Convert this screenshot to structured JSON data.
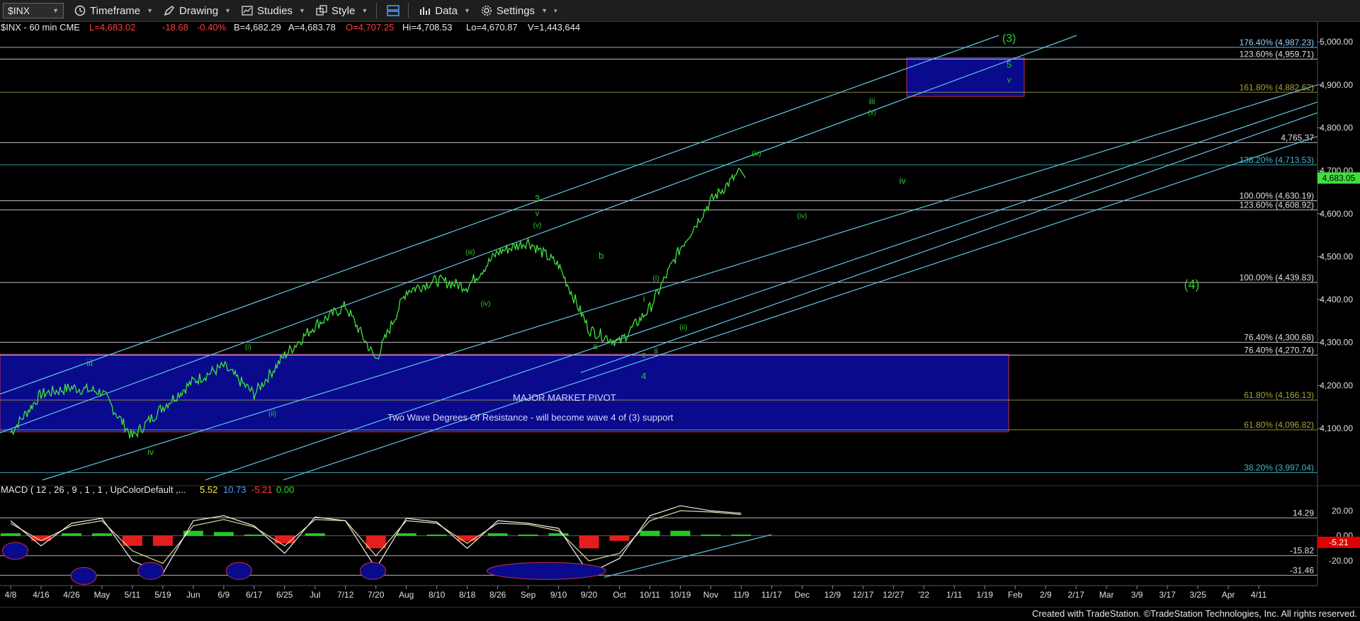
{
  "toolbar": {
    "symbol": "$INX",
    "timeframe": "Timeframe",
    "drawing": "Drawing",
    "studies": "Studies",
    "style": "Style",
    "data": "Data",
    "settings": "Settings"
  },
  "header": {
    "symbol_info": "$INX - 60 min  CME",
    "last": "L=4,683.02",
    "change": "-18.68",
    "change_pct": "-0.40%",
    "bid": "B=4,682.29",
    "ask": "A=4,683.78",
    "open": "O=4,707.25",
    "high": "Hi=4,708.53",
    "low": "Lo=4,670.87",
    "volume": "V=1,443,644"
  },
  "price_axis": {
    "ticks": [
      "5,000.00",
      "4,900.00",
      "4,800.00",
      "4,700.00",
      "4,600.00",
      "4,500.00",
      "4,400.00",
      "4,300.00",
      "4,200.00",
      "4,100.00"
    ],
    "last_price_tag": "4,683.05"
  },
  "date_axis": [
    "4/8",
    "4/16",
    "4/26",
    "May",
    "5/11",
    "5/19",
    "Jun",
    "6/9",
    "6/17",
    "6/25",
    "Jul",
    "7/12",
    "7/20",
    "Aug",
    "8/10",
    "8/18",
    "8/26",
    "Sep",
    "9/10",
    "9/20",
    "Oct",
    "10/11",
    "10/19",
    "Nov",
    "11/9",
    "11/17",
    "Dec",
    "12/9",
    "12/17",
    "12/27",
    "'22",
    "1/11",
    "1/19",
    "Feb",
    "2/9",
    "2/17",
    "Mar",
    "3/9",
    "3/17",
    "3/25",
    "Apr",
    "4/11"
  ],
  "fib_levels": [
    {
      "label": "176.40% (4,987.23)",
      "color": "#8fd3ff"
    },
    {
      "label": "123.60% (4,959.71)",
      "color": "#e0e0e0"
    },
    {
      "label": "161.80% (4,882.62)",
      "color": "#a8a23a"
    },
    {
      "label": "4,765.37",
      "color": "#e0e0e0"
    },
    {
      "label": "138.20% (4,713.53)",
      "color": "#43b7c7"
    },
    {
      "label": "100.00% (4,630.19)",
      "color": "#e0e0e0"
    },
    {
      "label": "123.60% (4,608.92)",
      "color": "#e0e0e0"
    },
    {
      "label": "100.00% (4,439.83)",
      "color": "#e0e0e0"
    },
    {
      "label": "76.40% (4,300.68)",
      "color": "#e0e0e0"
    },
    {
      "label": "76.40% (4,270.74)",
      "color": "#e0e0e0"
    },
    {
      "label": "61.80% (4,166.13)",
      "color": "#a8a23a"
    },
    {
      "label": "61.80% (4,096.82)",
      "color": "#a8a23a"
    },
    {
      "label": "38.20% (3,997.04)",
      "color": "#43b7c7"
    }
  ],
  "pivot_box": {
    "title": "MAJOR MARKET PIVOT",
    "subtitle": "Two Wave Degrees Of Resistance - will become wave 4 of (3) support"
  },
  "wave_labels": [
    "(3)",
    "5",
    "v",
    "iii",
    "(v)",
    "(iii)",
    "iv",
    "(iv)",
    "3",
    "v",
    "(v)",
    "(iii)",
    "(iv)",
    "b",
    "a",
    "c",
    "4",
    "ii",
    "i",
    "(i)",
    "(ii)",
    "(4)",
    "iii",
    "iv",
    "(i)",
    "(ii)"
  ],
  "macd": {
    "label": "MACD ( 12 , 26 , 9 , 1 , 1 , UpColorDefault ,...",
    "v1": "5.52",
    "v2": "10.73",
    "v3": "-5.21",
    "v4": "0.00",
    "axis_ticks": [
      "20.00",
      "0.00",
      "-20.00"
    ],
    "level_labels": [
      "14.29",
      "-15.82",
      "-31.46"
    ],
    "current_tag": "-5.21"
  },
  "footer": "Created with TradeStation. ©TradeStation Technologies, Inc. All rights reserved.",
  "colors": {
    "price": "#3fe03f",
    "channel": "#5fc6e6",
    "pivot_fill": "#0a0a8c",
    "pivot_border": "#c0304a",
    "macd_up": "#27e027",
    "macd_down": "#ff2020",
    "wave_label": "#2ccc2c"
  },
  "chart_data": {
    "type": "line",
    "title": "$INX - 60 min",
    "xlabel": "",
    "ylabel": "",
    "ylim": [
      3960,
      5015
    ],
    "series": [
      {
        "name": "$INX",
        "points": [
          [
            "4/8",
            4090
          ],
          [
            "4/16",
            4180
          ],
          [
            "4/26",
            4195
          ],
          [
            "May",
            4185
          ],
          [
            "5/11",
            4080
          ],
          [
            "5/19",
            4150
          ],
          [
            "Jun",
            4210
          ],
          [
            "6/9",
            4245
          ],
          [
            "6/17",
            4180
          ],
          [
            "6/25",
            4270
          ],
          [
            "Jul",
            4340
          ],
          [
            "7/12",
            4385
          ],
          [
            "7/20",
            4260
          ],
          [
            "Aug",
            4420
          ],
          [
            "8/10",
            4445
          ],
          [
            "8/18",
            4430
          ],
          [
            "8/26",
            4510
          ],
          [
            "Sep",
            4535
          ],
          [
            "9/10",
            4480
          ],
          [
            "9/20",
            4330
          ],
          [
            "Oct",
            4300
          ],
          [
            "10/11",
            4380
          ],
          [
            "10/19",
            4520
          ],
          [
            "Nov",
            4630
          ],
          [
            "11/9",
            4700
          ]
        ]
      }
    ],
    "macd": {
      "macd_line": [
        12,
        -8,
        10,
        14,
        -20,
        -30,
        12,
        16,
        8,
        -14,
        15,
        12,
        -26,
        14,
        11,
        -10,
        12,
        10,
        6,
        -30,
        -18,
        16,
        24,
        20,
        18
      ],
      "signal_line": [
        10,
        -4,
        8,
        12,
        -12,
        -22,
        8,
        13,
        7,
        -8,
        13,
        12,
        -16,
        12,
        10,
        -6,
        10,
        9,
        4,
        -20,
        -14,
        12,
        20,
        19,
        17
      ],
      "histogram": [
        2,
        -4,
        2,
        2,
        -8,
        -8,
        4,
        3,
        1,
        -6,
        2,
        0,
        -10,
        2,
        1,
        -4,
        2,
        1,
        2,
        -10,
        -4,
        4,
        4,
        1,
        1
      ]
    }
  }
}
